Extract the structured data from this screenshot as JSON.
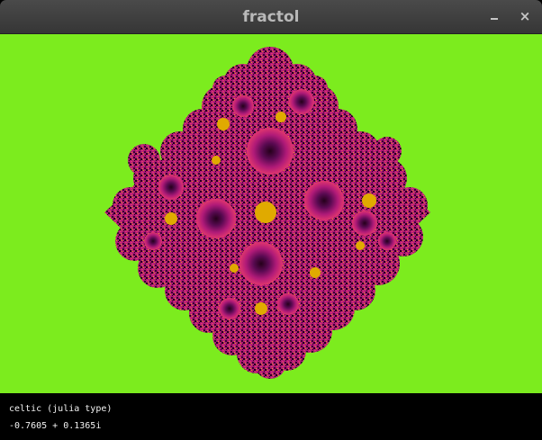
{
  "window": {
    "title": "fractol",
    "minimize_icon": "minimize-icon",
    "close_glyph": "×"
  },
  "canvas": {
    "background_color": "#7cec1e",
    "palette": {
      "dark": "#25001a",
      "magenta": "#b01a78",
      "purple": "#5a0a52",
      "pink": "#e0366e",
      "orange": "#f0a020",
      "gold": "#e0aa00"
    }
  },
  "info": {
    "fractal_name": "celtic (julia type)",
    "parameter": "-0.7605 + 0.1365i"
  }
}
